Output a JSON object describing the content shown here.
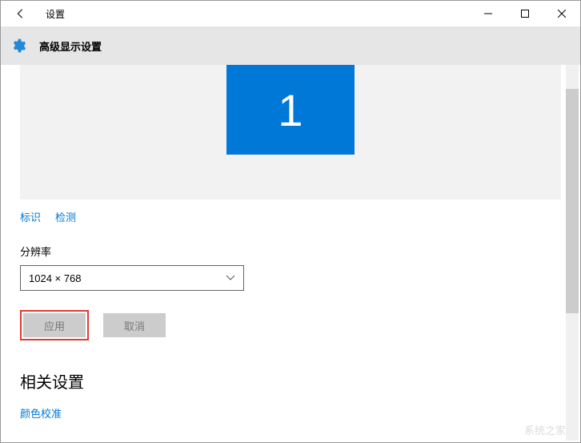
{
  "titlebar": {
    "title": "设置"
  },
  "header": {
    "title": "高级显示设置"
  },
  "monitor": {
    "number": "1"
  },
  "links": {
    "identify": "标识",
    "detect": "检测"
  },
  "resolution": {
    "label": "分辨率",
    "value": "1024 × 768"
  },
  "buttons": {
    "apply": "应用",
    "cancel": "取消"
  },
  "related": {
    "heading": "相关设置",
    "color_calibration": "颜色校准"
  },
  "watermark": "系统之家"
}
